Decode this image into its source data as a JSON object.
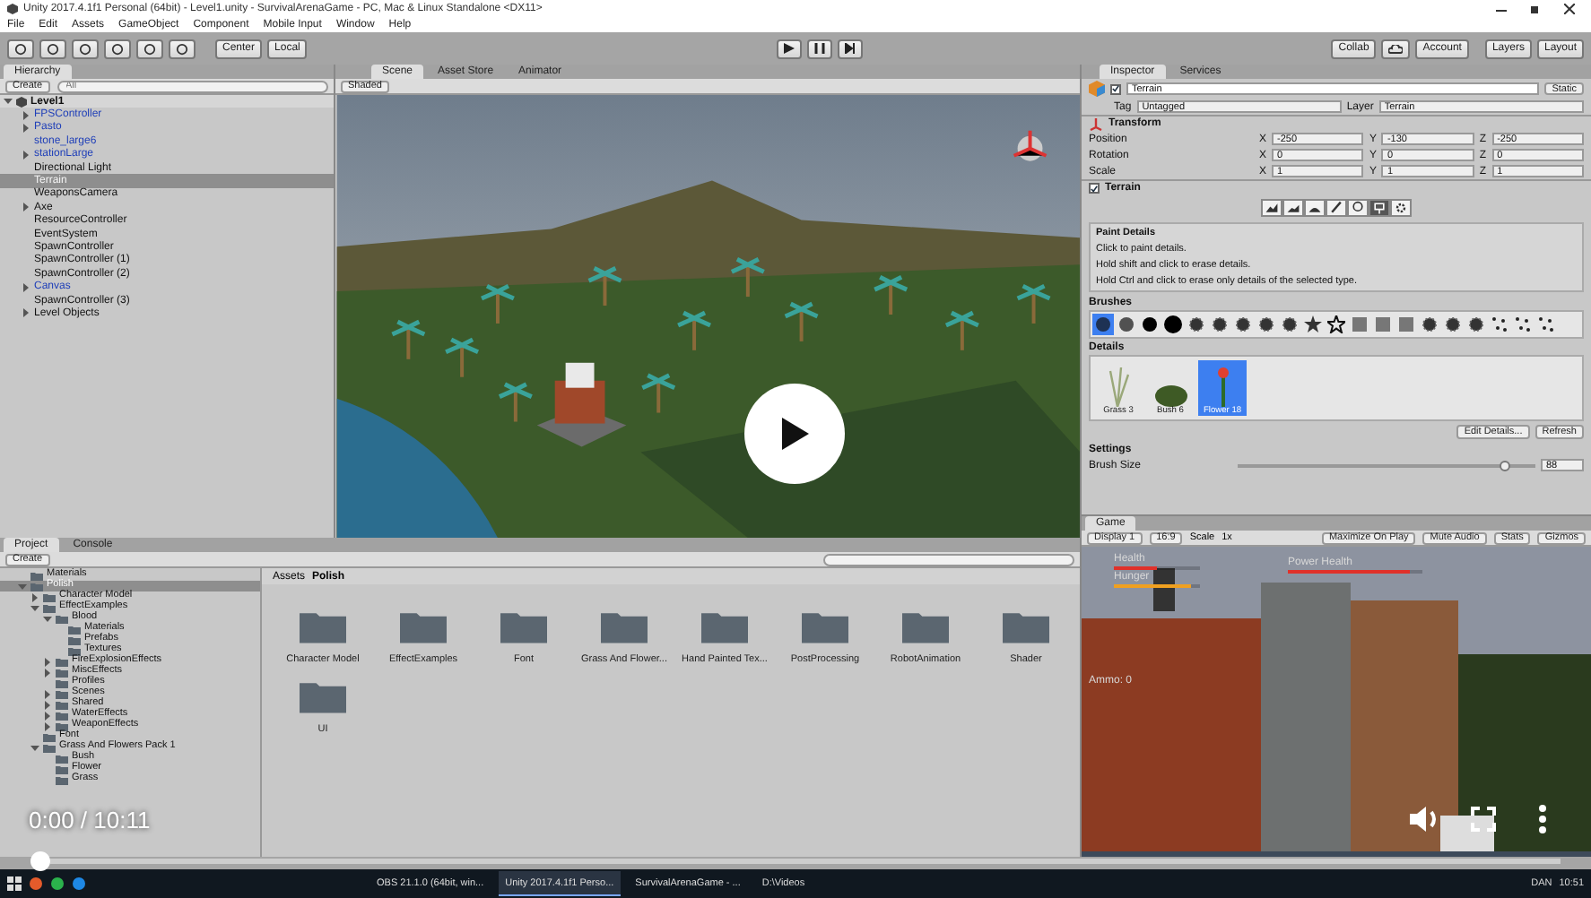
{
  "window": {
    "title": "Unity 2017.4.1f1 Personal (64bit) - Level1.unity - SurvivalArenaGame - PC, Mac & Linux Standalone <DX11>"
  },
  "menu": [
    "File",
    "Edit",
    "Assets",
    "GameObject",
    "Component",
    "Mobile Input",
    "Window",
    "Help"
  ],
  "toolbar": {
    "pivot": "Center",
    "space": "Local",
    "collab": "Collab",
    "account": "Account",
    "layers": "Layers",
    "layout": "Layout"
  },
  "hierarchy": {
    "tab": "Hierarchy",
    "create": "Create",
    "placeholder": "All",
    "root": {
      "label": "Level1",
      "expanded": true,
      "children": [
        {
          "label": "FPSController",
          "prefab": true,
          "expandable": true,
          "selected": false
        },
        {
          "label": "Pasto",
          "prefab": true,
          "expandable": true,
          "selected": false
        },
        {
          "label": "stone_large6",
          "prefab": true,
          "expandable": false,
          "selected": false
        },
        {
          "label": "stationLarge",
          "prefab": true,
          "expandable": true,
          "selected": false
        },
        {
          "label": "Directional Light",
          "prefab": false,
          "expandable": false,
          "selected": false
        },
        {
          "label": "Terrain",
          "prefab": false,
          "expandable": false,
          "selected": true
        },
        {
          "label": "WeaponsCamera",
          "prefab": false,
          "expandable": false,
          "selected": false
        },
        {
          "label": "Axe",
          "prefab": false,
          "expandable": true,
          "selected": false
        },
        {
          "label": "ResourceController",
          "prefab": false,
          "expandable": false,
          "selected": false
        },
        {
          "label": "EventSystem",
          "prefab": false,
          "expandable": false,
          "selected": false
        },
        {
          "label": "SpawnController",
          "prefab": false,
          "expandable": false,
          "selected": false
        },
        {
          "label": "SpawnController (1)",
          "prefab": false,
          "expandable": false,
          "selected": false
        },
        {
          "label": "SpawnController (2)",
          "prefab": false,
          "expandable": false,
          "selected": false
        },
        {
          "label": "Canvas",
          "prefab": true,
          "expandable": true,
          "selected": false
        },
        {
          "label": "SpawnController (3)",
          "prefab": false,
          "expandable": false,
          "selected": false
        },
        {
          "label": "Level Objects",
          "prefab": false,
          "expandable": true,
          "selected": false
        }
      ]
    }
  },
  "scene": {
    "tabs": [
      {
        "label": "Scene",
        "selected": true
      },
      {
        "label": "Asset Store",
        "selected": false
      },
      {
        "label": "Animator",
        "selected": false
      }
    ],
    "shading": "Shaded"
  },
  "inspector": {
    "tabs": [
      {
        "label": "Inspector",
        "selected": true
      },
      {
        "label": "Services",
        "selected": false
      }
    ],
    "object": {
      "name": "Terrain",
      "active": true,
      "static": "Static",
      "tag_label": "Tag",
      "tag": "Untagged",
      "layer_label": "Layer",
      "layer": "Terrain"
    },
    "transform": {
      "title": "Transform",
      "rows": [
        {
          "label": "Position",
          "fields": [
            {
              "axis": "X",
              "value": "-250"
            },
            {
              "axis": "Y",
              "value": "-130"
            },
            {
              "axis": "Z",
              "value": "-250"
            }
          ]
        },
        {
          "label": "Rotation",
          "fields": [
            {
              "axis": "X",
              "value": "0"
            },
            {
              "axis": "Y",
              "value": "0"
            },
            {
              "axis": "Z",
              "value": "0"
            }
          ]
        },
        {
          "label": "Scale",
          "fields": [
            {
              "axis": "X",
              "value": "1"
            },
            {
              "axis": "Y",
              "value": "1"
            },
            {
              "axis": "Z",
              "value": "1"
            }
          ]
        }
      ]
    },
    "terrain": {
      "title": "Terrain",
      "enabled": true,
      "tools": [
        {
          "kind": "raise",
          "selected": false
        },
        {
          "kind": "height",
          "selected": false
        },
        {
          "kind": "smooth",
          "selected": false
        },
        {
          "kind": "texture",
          "selected": false
        },
        {
          "kind": "tree",
          "selected": false
        },
        {
          "kind": "detail",
          "selected": true
        },
        {
          "kind": "settings",
          "selected": false
        }
      ],
      "help_title": "Paint Details",
      "help": [
        "Click to paint details.",
        "Hold shift and click to erase details.",
        "Hold Ctrl and click to erase only details of the selected type."
      ],
      "brushes_title": "Brushes",
      "brushes": [
        {
          "kind": "soft",
          "selected": true
        },
        {
          "kind": "soft",
          "selected": false
        },
        {
          "kind": "hard",
          "selected": false
        },
        {
          "kind": "large",
          "selected": false
        },
        {
          "kind": "splat",
          "selected": false
        },
        {
          "kind": "splat",
          "selected": false
        },
        {
          "kind": "splat",
          "selected": false
        },
        {
          "kind": "splat",
          "selected": false
        },
        {
          "kind": "splat",
          "selected": false
        },
        {
          "kind": "star",
          "selected": false
        },
        {
          "kind": "outline",
          "selected": false
        },
        {
          "kind": "noise",
          "selected": false
        },
        {
          "kind": "noise",
          "selected": false
        },
        {
          "kind": "noise",
          "selected": false
        },
        {
          "kind": "splat",
          "selected": false
        },
        {
          "kind": "splat",
          "selected": false
        },
        {
          "kind": "splat",
          "selected": false
        },
        {
          "kind": "dots",
          "selected": false
        },
        {
          "kind": "dots",
          "selected": false
        },
        {
          "kind": "dots",
          "selected": false
        }
      ],
      "details_title": "Details",
      "details": [
        {
          "label": "Grass 3",
          "kind": "grass",
          "selected": false
        },
        {
          "label": "Bush 6",
          "kind": "bush",
          "selected": false
        },
        {
          "label": "Flower 18",
          "kind": "flower",
          "selected": true
        }
      ],
      "buttons": [
        "Edit Details...",
        "Refresh"
      ],
      "settings_title": "Settings",
      "brush_size": {
        "label": "Brush Size",
        "level": 0.9,
        "value": "88"
      }
    }
  },
  "game": {
    "tab": "Game",
    "display": "Display 1",
    "aspect": "16:9",
    "scale_label": "Scale",
    "scale": "1x",
    "buttons": [
      "Maximize On Play",
      "Mute Audio",
      "Stats",
      "Gizmos"
    ],
    "bars": [
      {
        "label": "Health",
        "level": 0.5,
        "color": "#e0312a"
      },
      {
        "label": "Hunger",
        "level": 0.9,
        "color": "#f0a020"
      }
    ],
    "power": {
      "label": "Power Health",
      "level": 0.9,
      "color": "#e0312a"
    },
    "ammo": "Ammo: 0"
  },
  "project": {
    "tabs": [
      {
        "label": "Project",
        "selected": true
      },
      {
        "label": "Console",
        "selected": false
      }
    ],
    "create": "Create",
    "tree": [
      {
        "label": "Materials",
        "expandable": false,
        "expanded": false,
        "selected": false
      },
      {
        "label": "Polish",
        "expandable": true,
        "expanded": true,
        "selected": true,
        "children": [
          {
            "label": "Character Model",
            "expandable": true,
            "expanded": false,
            "selected": false
          },
          {
            "label": "EffectExamples",
            "expandable": true,
            "expanded": true,
            "selected": false,
            "children": [
              {
                "label": "Blood",
                "expandable": true,
                "expanded": true,
                "selected": false,
                "children": [
                  {
                    "label": "Materials",
                    "expandable": false,
                    "expanded": false,
                    "selected": false
                  },
                  {
                    "label": "Prefabs",
                    "expandable": false,
                    "expanded": false,
                    "selected": false
                  },
                  {
                    "label": "Textures",
                    "expandable": false,
                    "expanded": false,
                    "selected": false
                  }
                ]
              },
              {
                "label": "FireExplosionEffects",
                "expandable": true,
                "expanded": false,
                "selected": false
              },
              {
                "label": "MiscEffects",
                "expandable": true,
                "expanded": false,
                "selected": false
              },
              {
                "label": "Profiles",
                "expandable": false,
                "expanded": false,
                "selected": false
              },
              {
                "label": "Scenes",
                "expandable": true,
                "expanded": false,
                "selected": false
              },
              {
                "label": "Shared",
                "expandable": true,
                "expanded": false,
                "selected": false
              },
              {
                "label": "WaterEffects",
                "expandable": true,
                "expanded": false,
                "selected": false
              },
              {
                "label": "WeaponEffects",
                "expandable": true,
                "expanded": false,
                "selected": false
              }
            ]
          },
          {
            "label": "Font",
            "expandable": false,
            "expanded": false,
            "selected": false
          },
          {
            "label": "Grass And Flowers Pack 1",
            "expandable": true,
            "expanded": true,
            "selected": false,
            "children": [
              {
                "label": "Bush",
                "expandable": false,
                "expanded": false,
                "selected": false
              },
              {
                "label": "Flower",
                "expandable": false,
                "expanded": false,
                "selected": false
              },
              {
                "label": "Grass",
                "expandable": false,
                "expanded": false,
                "selected": false
              }
            ]
          }
        ]
      }
    ],
    "breadcrumb": [
      "Assets",
      "Polish"
    ],
    "folders": [
      "Character Model",
      "EffectExamples",
      "Font",
      "Grass And Flower...",
      "Hand Painted Tex...",
      "PostProcessing",
      "RobotAnimation",
      "Shader",
      "UI"
    ]
  },
  "video": {
    "time": "0:00 / 10:11",
    "level": 0
  },
  "taskbar": {
    "items": [
      {
        "label": "OBS 21.1.0 (64bit, win...",
        "active": false
      },
      {
        "label": "Unity 2017.4.1f1 Perso...",
        "active": true
      },
      {
        "label": "SurvivalArenaGame - ...",
        "active": false
      },
      {
        "label": "D:\\Videos",
        "active": false
      }
    ],
    "tray": [
      "DAN",
      "10:51"
    ]
  }
}
